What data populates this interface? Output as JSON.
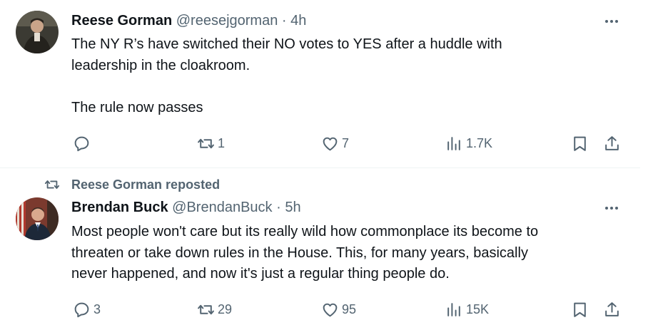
{
  "tweets": [
    {
      "author": "Reese Gorman",
      "handle": "@reesejgorman",
      "separator": "·",
      "time": "4h",
      "text_lines": [
        "The NY R’s have switched their NO votes to YES after a huddle with",
        "leadership in the cloakroom.",
        "",
        "The rule now passes"
      ],
      "replies": "",
      "reposts": "1",
      "likes": "7",
      "views": "1.7K"
    },
    {
      "repost_label": "Reese Gorman reposted",
      "author": "Brendan Buck",
      "handle": "@BrendanBuck",
      "separator": "·",
      "time": "5h",
      "text_lines": [
        "Most people won't care but its really wild how commonplace its become to",
        "threaten or take down rules in the House. This, for many years, basically",
        "never happened, and now it's just a regular thing people do."
      ],
      "replies": "3",
      "reposts": "29",
      "likes": "95",
      "views": "15K"
    }
  ],
  "colors": {
    "text": "#0f1419",
    "muted": "#536471",
    "divider": "#eff3f4"
  },
  "icons": [
    "more-icon",
    "reply-icon",
    "repost-icon",
    "like-icon",
    "views-icon",
    "bookmark-icon",
    "share-icon"
  ]
}
